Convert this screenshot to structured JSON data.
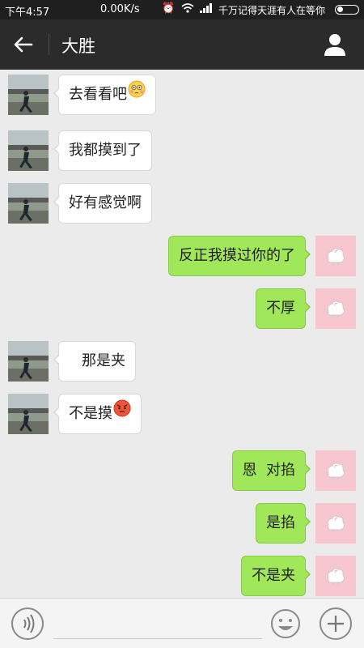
{
  "status_bar": {
    "time": "下午4:57",
    "network_speed": "0.00K/s",
    "marquee": "千万记得天涯有人在等你"
  },
  "nav": {
    "title": "大胜"
  },
  "messages": [
    {
      "side": "in",
      "text": "去看看吧",
      "emoji": "flushed-face"
    },
    {
      "side": "in",
      "text": "我都摸到了"
    },
    {
      "side": "in",
      "text": "好有感觉啊"
    },
    {
      "side": "out",
      "text": "反正我摸过你的了"
    },
    {
      "side": "out",
      "text": "不厚"
    },
    {
      "side": "in",
      "text": "那是夹"
    },
    {
      "side": "in",
      "text": "不是摸",
      "emoji": "angry-face"
    },
    {
      "side": "out",
      "text": "恩  对掐"
    },
    {
      "side": "out",
      "text": "是掐"
    },
    {
      "side": "out",
      "text": "不是夹"
    }
  ],
  "input_bar": {
    "placeholder": ""
  },
  "colors": {
    "outgoing_bubble": "#a0e75a",
    "incoming_bubble": "#ffffff",
    "nav_background": "#2b2b2b",
    "my_avatar_background": "#f7c6cf"
  }
}
